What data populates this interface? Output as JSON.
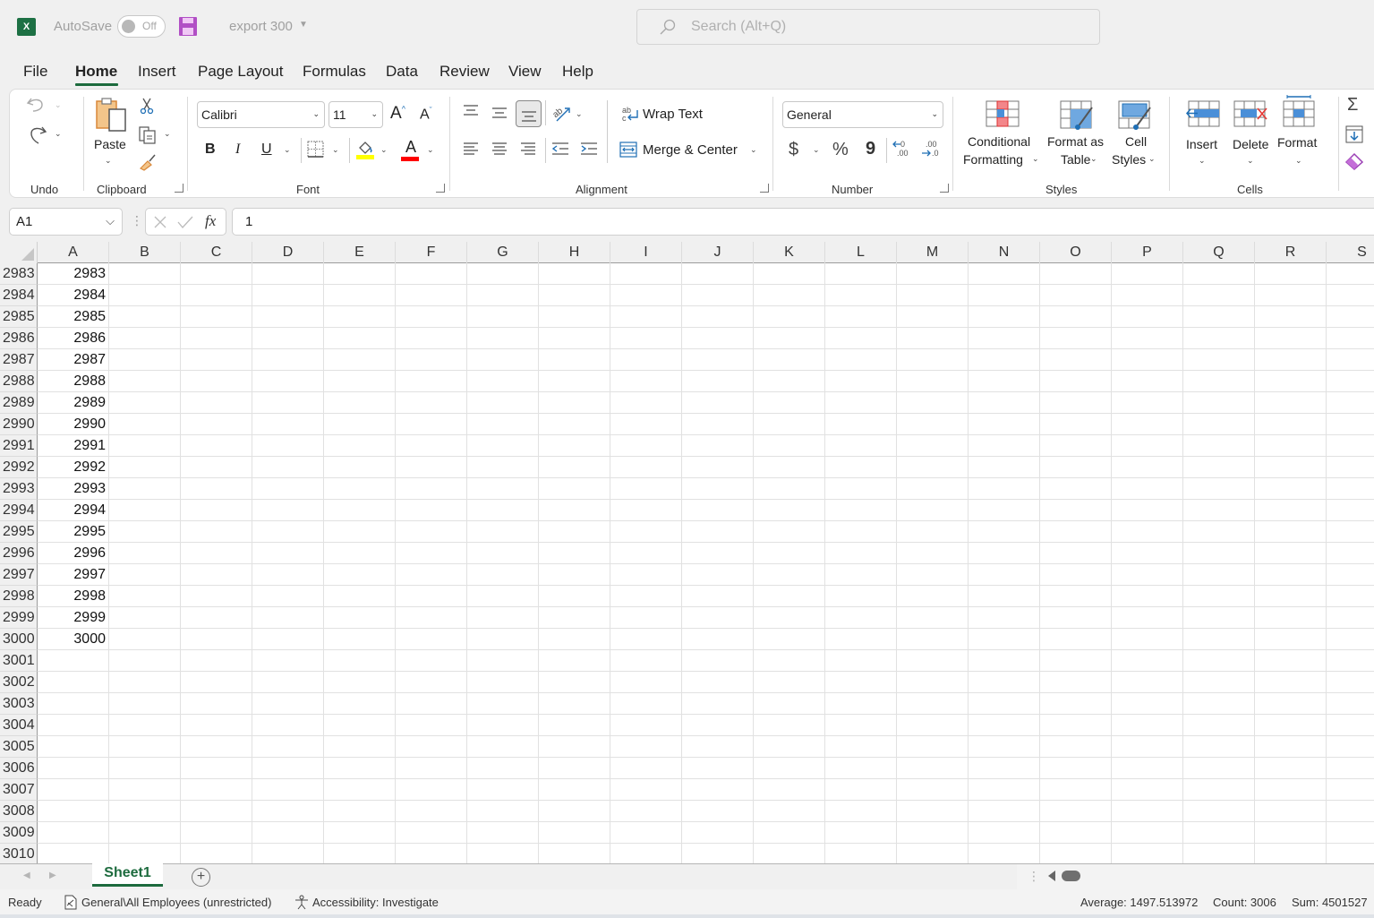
{
  "titlebar": {
    "app_icon": "excel-icon",
    "autosave_label": "AutoSave",
    "autosave_state": "Off",
    "save_icon": "save-icon",
    "document_title": "export 300",
    "search_placeholder": "Search (Alt+Q)"
  },
  "menu": {
    "tabs": [
      {
        "label": "File",
        "active": false
      },
      {
        "label": "Home",
        "active": true
      },
      {
        "label": "Insert",
        "active": false
      },
      {
        "label": "Page Layout",
        "active": false
      },
      {
        "label": "Formulas",
        "active": false
      },
      {
        "label": "Data",
        "active": false
      },
      {
        "label": "Review",
        "active": false
      },
      {
        "label": "View",
        "active": false
      },
      {
        "label": "Help",
        "active": false
      }
    ]
  },
  "ribbon": {
    "groups": {
      "undo": {
        "label": "Undo"
      },
      "clipboard": {
        "label": "Clipboard",
        "paste_label": "Paste"
      },
      "font": {
        "label": "Font",
        "font_name": "Calibri",
        "font_size": "11",
        "bold": "B",
        "italic": "I",
        "underline": "U",
        "font_color_glyph": "A",
        "grow": "A",
        "shrink": "A"
      },
      "alignment": {
        "label": "Alignment",
        "wrap_text": "Wrap Text",
        "merge_center": "Merge & Center"
      },
      "number": {
        "label": "Number",
        "format": "General",
        "currency": "$",
        "percent": "%",
        "comma": "9"
      },
      "styles": {
        "label": "Styles",
        "conditional_1": "Conditional",
        "conditional_2": "Formatting",
        "format_table_1": "Format as",
        "format_table_2": "Table",
        "cell_styles_1": "Cell",
        "cell_styles_2": "Styles"
      },
      "cells": {
        "label": "Cells",
        "insert": "Insert",
        "delete": "Delete",
        "format": "Format"
      },
      "editing": {
        "sum_glyph": "Σ"
      }
    },
    "colors": {
      "highlight": "#ffff00",
      "font_color": "#ff0000",
      "accent": "#1d6b3e"
    }
  },
  "formula_bar": {
    "name_box": "A1",
    "fx": "fx",
    "value": "1"
  },
  "grid": {
    "columns": [
      "A",
      "B",
      "C",
      "D",
      "E",
      "F",
      "G",
      "H",
      "I",
      "J",
      "K",
      "L",
      "M",
      "N",
      "O",
      "P",
      "Q",
      "R",
      "S"
    ],
    "rows": [
      {
        "row": "2983",
        "A": "2983"
      },
      {
        "row": "2984",
        "A": "2984"
      },
      {
        "row": "2985",
        "A": "2985"
      },
      {
        "row": "2986",
        "A": "2986"
      },
      {
        "row": "2987",
        "A": "2987"
      },
      {
        "row": "2988",
        "A": "2988"
      },
      {
        "row": "2989",
        "A": "2989"
      },
      {
        "row": "2990",
        "A": "2990"
      },
      {
        "row": "2991",
        "A": "2991"
      },
      {
        "row": "2992",
        "A": "2992"
      },
      {
        "row": "2993",
        "A": "2993"
      },
      {
        "row": "2994",
        "A": "2994"
      },
      {
        "row": "2995",
        "A": "2995"
      },
      {
        "row": "2996",
        "A": "2996"
      },
      {
        "row": "2997",
        "A": "2997"
      },
      {
        "row": "2998",
        "A": "2998"
      },
      {
        "row": "2999",
        "A": "2999"
      },
      {
        "row": "3000",
        "A": "3000"
      },
      {
        "row": "3001",
        "A": ""
      },
      {
        "row": "3002",
        "A": ""
      },
      {
        "row": "3003",
        "A": ""
      },
      {
        "row": "3004",
        "A": ""
      },
      {
        "row": "3005",
        "A": ""
      },
      {
        "row": "3006",
        "A": ""
      },
      {
        "row": "3007",
        "A": ""
      },
      {
        "row": "3008",
        "A": ""
      },
      {
        "row": "3009",
        "A": ""
      },
      {
        "row": "3010",
        "A": ""
      }
    ]
  },
  "sheets": {
    "tabs": [
      {
        "label": "Sheet1",
        "active": true
      }
    ],
    "add_icon": "plus-icon"
  },
  "status": {
    "ready": "Ready",
    "sensitivity": "General\\All Employees (unrestricted)",
    "accessibility": "Accessibility: Investigate",
    "average": "Average: 1497.513972",
    "count": "Count: 3006",
    "sum": "Sum: 4501527"
  }
}
